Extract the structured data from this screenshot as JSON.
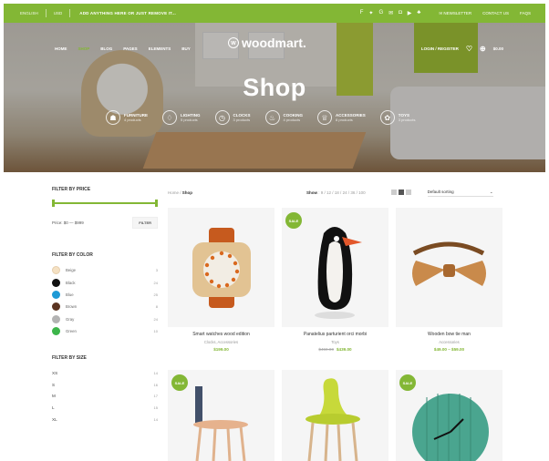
{
  "topbar": {
    "language": "ENGLISH",
    "currency": "USD",
    "promo": "ADD ANYTHING HERE OR JUST REMOVE IT...",
    "social_icons": [
      "facebook-icon",
      "twitter-icon",
      "google-plus-icon",
      "email-icon",
      "instagram-icon",
      "youtube-icon",
      "pinterest-icon"
    ],
    "newsletter": "NEWSLETTER",
    "contact": "CONTACT US",
    "faqs": "FAQS"
  },
  "nav": {
    "items": [
      "HOME",
      "SHOP",
      "BLOG",
      "PAGES",
      "ELEMENTS",
      "BUY"
    ],
    "active_index": 1,
    "brand": "woodmart.",
    "login": "LOGIN / REGISTER",
    "cart": "$0.00"
  },
  "hero": {
    "title": "Shop",
    "categories": [
      {
        "name": "FURNITURE",
        "count": "4 products",
        "icon": "☗"
      },
      {
        "name": "LIGHTING",
        "count": "5 products",
        "icon": "♢"
      },
      {
        "name": "CLOCKS",
        "count": "3 products",
        "icon": "◷"
      },
      {
        "name": "COOKING",
        "count": "4 products",
        "icon": "♨"
      },
      {
        "name": "ACCESSORIES",
        "count": "8 products",
        "icon": "♕"
      },
      {
        "name": "TOYS",
        "count": "3 products",
        "icon": "✿"
      }
    ]
  },
  "sidebar": {
    "price_title": "FILTER BY PRICE",
    "price_range": "Price: $0 — $999",
    "filter_button": "FILTER",
    "color_title": "FILTER BY COLOR",
    "colors": [
      {
        "name": "Beige",
        "count": "3",
        "hex": "#f5e1c3"
      },
      {
        "name": "Black",
        "count": "24",
        "hex": "#111111"
      },
      {
        "name": "Blue",
        "count": "25",
        "hex": "#1e9ad6"
      },
      {
        "name": "Brown",
        "count": "8",
        "hex": "#5b3421"
      },
      {
        "name": "Gray",
        "count": "24",
        "hex": "#b3b3b3"
      },
      {
        "name": "Green",
        "count": "10",
        "hex": "#3cb54a"
      }
    ],
    "size_title": "FILTER BY SIZE",
    "sizes": [
      {
        "name": "XS",
        "count": "14"
      },
      {
        "name": "S",
        "count": "16"
      },
      {
        "name": "M",
        "count": "17"
      },
      {
        "name": "L",
        "count": "15"
      },
      {
        "name": "XL",
        "count": "14"
      }
    ]
  },
  "toolbar": {
    "breadcrumb_home": "Home",
    "breadcrumb_current": "Shop",
    "show_label": "Show",
    "show_options": "9 / 12 / 18 / 24 / 36 / 100",
    "sort": "Default sorting"
  },
  "products": [
    {
      "name": "Smart watches wood edition",
      "category": "Clocks, Accessories",
      "price": "$199.00",
      "old_price": "",
      "sale": ""
    },
    {
      "name": "Panatelius parturient orci morbi",
      "category": "Toys",
      "price": "$439.00",
      "old_price": "$459.00",
      "sale": "SALE"
    },
    {
      "name": "Wooden bow tie man",
      "category": "Accessories",
      "price": "$49.00 – $59.00",
      "old_price": "",
      "sale": ""
    },
    {
      "name": "",
      "category": "",
      "price": "",
      "old_price": "",
      "sale": "SALE"
    },
    {
      "name": "",
      "category": "",
      "price": "",
      "old_price": "",
      "sale": ""
    },
    {
      "name": "",
      "category": "",
      "price": "",
      "old_price": "",
      "sale": "SALE"
    }
  ],
  "colors": {
    "accent": "#83b735"
  }
}
